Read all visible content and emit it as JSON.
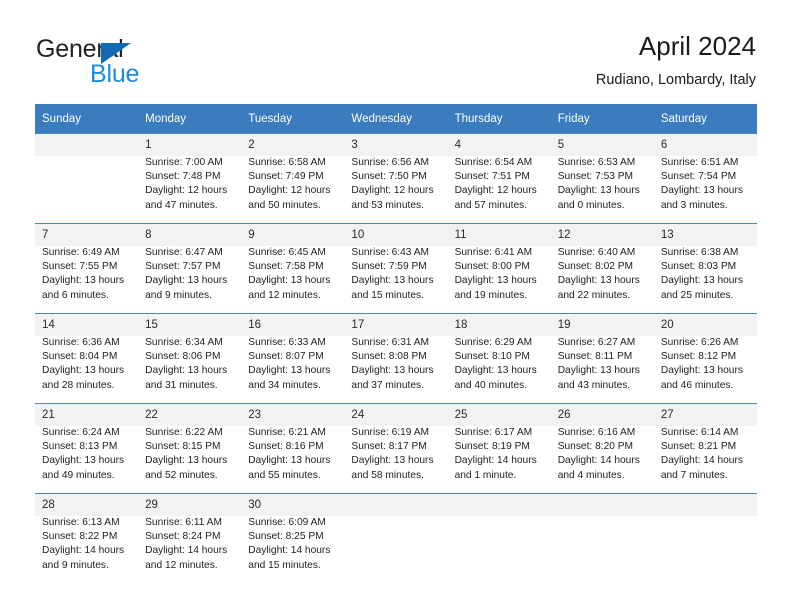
{
  "brand": {
    "name_part1": "General",
    "name_part2": "Blue",
    "logo_icon": "blue-triangle-logo"
  },
  "header": {
    "title": "April 2024",
    "subtitle": "Rudiano, Lombardy, Italy"
  },
  "colors": {
    "header_row": "#3a7cbe",
    "brand_blue": "#1b8cdc",
    "logo_blue": "#1268b3",
    "shaded_row": "#f2f2f2",
    "grid_line": "#4f86c0"
  },
  "calendar": {
    "weekday_headers": [
      "Sunday",
      "Monday",
      "Tuesday",
      "Wednesday",
      "Thursday",
      "Friday",
      "Saturday"
    ],
    "weeks": [
      [
        {
          "day": "",
          "text": "",
          "empty": true
        },
        {
          "day": "1",
          "text": "Sunrise: 7:00 AM\nSunset: 7:48 PM\nDaylight: 12 hours and 47 minutes."
        },
        {
          "day": "2",
          "text": "Sunrise: 6:58 AM\nSunset: 7:49 PM\nDaylight: 12 hours and 50 minutes."
        },
        {
          "day": "3",
          "text": "Sunrise: 6:56 AM\nSunset: 7:50 PM\nDaylight: 12 hours and 53 minutes."
        },
        {
          "day": "4",
          "text": "Sunrise: 6:54 AM\nSunset: 7:51 PM\nDaylight: 12 hours and 57 minutes."
        },
        {
          "day": "5",
          "text": "Sunrise: 6:53 AM\nSunset: 7:53 PM\nDaylight: 13 hours and 0 minutes."
        },
        {
          "day": "6",
          "text": "Sunrise: 6:51 AM\nSunset: 7:54 PM\nDaylight: 13 hours and 3 minutes."
        }
      ],
      [
        {
          "day": "7",
          "text": "Sunrise: 6:49 AM\nSunset: 7:55 PM\nDaylight: 13 hours and 6 minutes."
        },
        {
          "day": "8",
          "text": "Sunrise: 6:47 AM\nSunset: 7:57 PM\nDaylight: 13 hours and 9 minutes."
        },
        {
          "day": "9",
          "text": "Sunrise: 6:45 AM\nSunset: 7:58 PM\nDaylight: 13 hours and 12 minutes."
        },
        {
          "day": "10",
          "text": "Sunrise: 6:43 AM\nSunset: 7:59 PM\nDaylight: 13 hours and 15 minutes."
        },
        {
          "day": "11",
          "text": "Sunrise: 6:41 AM\nSunset: 8:00 PM\nDaylight: 13 hours and 19 minutes."
        },
        {
          "day": "12",
          "text": "Sunrise: 6:40 AM\nSunset: 8:02 PM\nDaylight: 13 hours and 22 minutes."
        },
        {
          "day": "13",
          "text": "Sunrise: 6:38 AM\nSunset: 8:03 PM\nDaylight: 13 hours and 25 minutes."
        }
      ],
      [
        {
          "day": "14",
          "text": "Sunrise: 6:36 AM\nSunset: 8:04 PM\nDaylight: 13 hours and 28 minutes."
        },
        {
          "day": "15",
          "text": "Sunrise: 6:34 AM\nSunset: 8:06 PM\nDaylight: 13 hours and 31 minutes."
        },
        {
          "day": "16",
          "text": "Sunrise: 6:33 AM\nSunset: 8:07 PM\nDaylight: 13 hours and 34 minutes."
        },
        {
          "day": "17",
          "text": "Sunrise: 6:31 AM\nSunset: 8:08 PM\nDaylight: 13 hours and 37 minutes."
        },
        {
          "day": "18",
          "text": "Sunrise: 6:29 AM\nSunset: 8:10 PM\nDaylight: 13 hours and 40 minutes."
        },
        {
          "day": "19",
          "text": "Sunrise: 6:27 AM\nSunset: 8:11 PM\nDaylight: 13 hours and 43 minutes."
        },
        {
          "day": "20",
          "text": "Sunrise: 6:26 AM\nSunset: 8:12 PM\nDaylight: 13 hours and 46 minutes."
        }
      ],
      [
        {
          "day": "21",
          "text": "Sunrise: 6:24 AM\nSunset: 8:13 PM\nDaylight: 13 hours and 49 minutes."
        },
        {
          "day": "22",
          "text": "Sunrise: 6:22 AM\nSunset: 8:15 PM\nDaylight: 13 hours and 52 minutes."
        },
        {
          "day": "23",
          "text": "Sunrise: 6:21 AM\nSunset: 8:16 PM\nDaylight: 13 hours and 55 minutes."
        },
        {
          "day": "24",
          "text": "Sunrise: 6:19 AM\nSunset: 8:17 PM\nDaylight: 13 hours and 58 minutes."
        },
        {
          "day": "25",
          "text": "Sunrise: 6:17 AM\nSunset: 8:19 PM\nDaylight: 14 hours and 1 minute."
        },
        {
          "day": "26",
          "text": "Sunrise: 6:16 AM\nSunset: 8:20 PM\nDaylight: 14 hours and 4 minutes."
        },
        {
          "day": "27",
          "text": "Sunrise: 6:14 AM\nSunset: 8:21 PM\nDaylight: 14 hours and 7 minutes."
        }
      ],
      [
        {
          "day": "28",
          "text": "Sunrise: 6:13 AM\nSunset: 8:22 PM\nDaylight: 14 hours and 9 minutes."
        },
        {
          "day": "29",
          "text": "Sunrise: 6:11 AM\nSunset: 8:24 PM\nDaylight: 14 hours and 12 minutes."
        },
        {
          "day": "30",
          "text": "Sunrise: 6:09 AM\nSunset: 8:25 PM\nDaylight: 14 hours and 15 minutes."
        },
        {
          "day": "",
          "text": "",
          "empty": true
        },
        {
          "day": "",
          "text": "",
          "empty": true
        },
        {
          "day": "",
          "text": "",
          "empty": true
        },
        {
          "day": "",
          "text": "",
          "empty": true
        }
      ]
    ]
  }
}
